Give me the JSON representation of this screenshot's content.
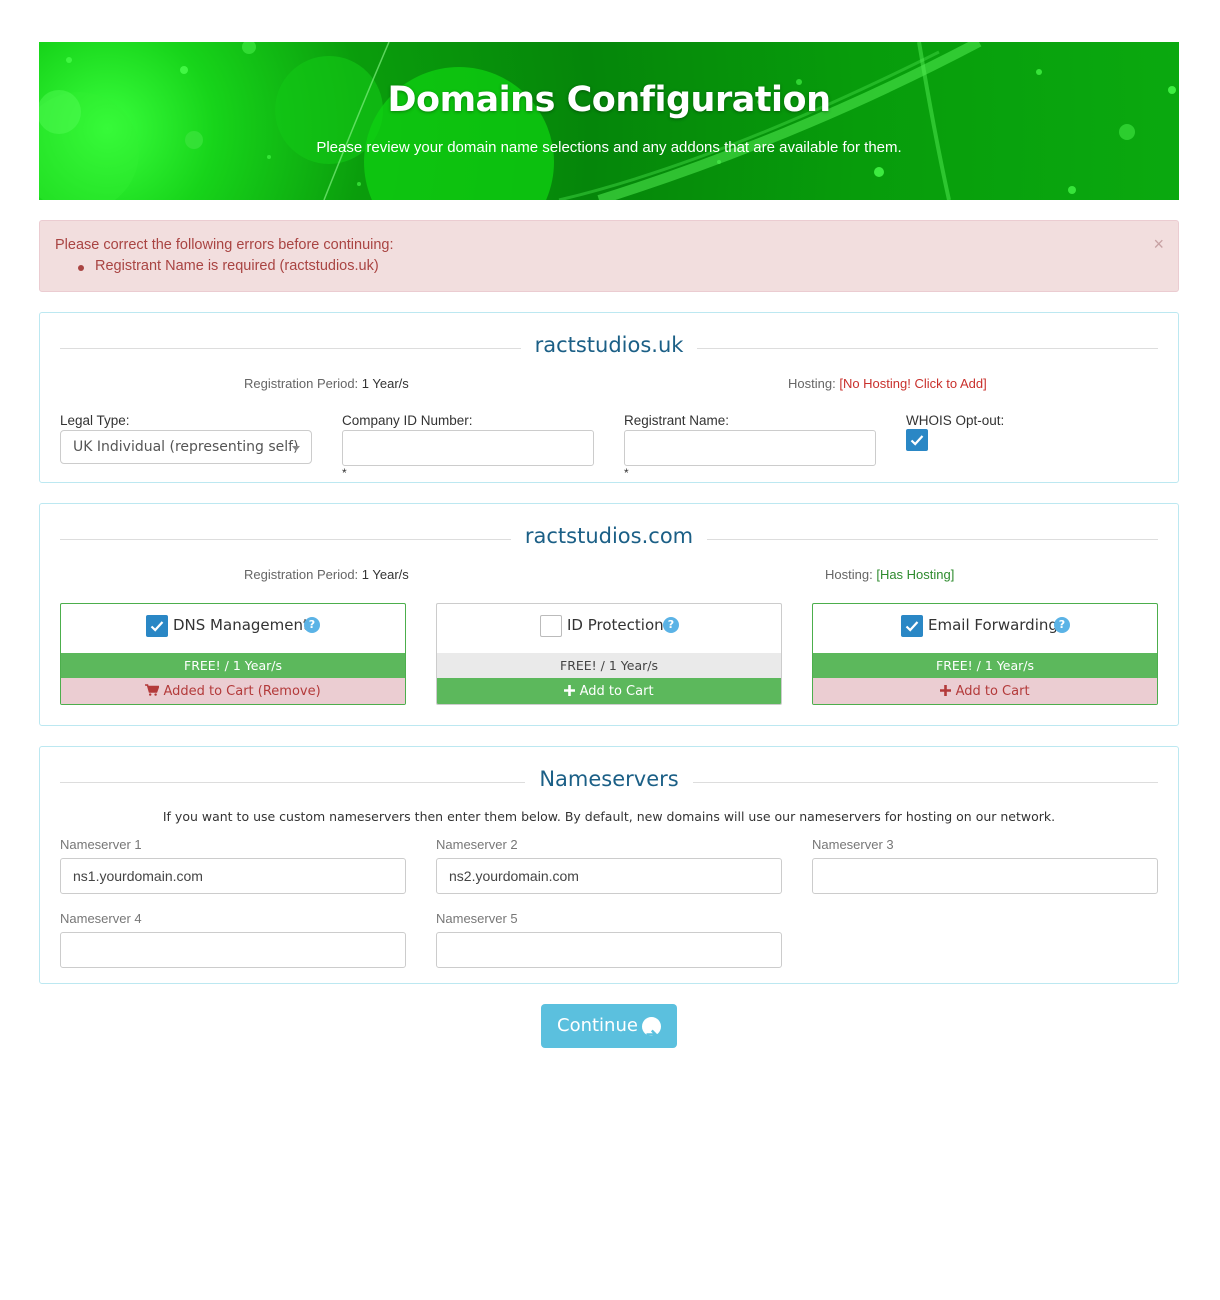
{
  "banner": {
    "title": "Domains Configuration",
    "subtitle": "Please review your domain name selections and any addons that are available for them."
  },
  "alert": {
    "heading": "Please correct the following errors before continuing:",
    "errors": [
      "Registrant Name is required (ractstudios.uk)"
    ],
    "close_glyph": "×"
  },
  "domain_uk": {
    "name": "ractstudios.uk",
    "reg_period_label": "Registration Period:",
    "reg_period_value": "1 Year/s",
    "hosting_label": "Hosting:",
    "hosting_value": "[No Hosting! Click to Add]",
    "legal_type_label": "Legal Type:",
    "legal_type_value": "UK Individual (representing self)",
    "company_id_label": "Company ID Number:",
    "company_id_value": "",
    "registrant_name_label": "Registrant Name:",
    "registrant_name_value": "",
    "required_mark": "*",
    "whois_label": "WHOIS Opt-out:",
    "whois_checked": true
  },
  "domain_com": {
    "name": "ractstudios.com",
    "reg_period_label": "Registration Period:",
    "reg_period_value": "1 Year/s",
    "hosting_label": "Hosting:",
    "hosting_value": "[Has Hosting]",
    "addons": [
      {
        "name": "DNS Management",
        "checked": true,
        "price": "FREE! / 1 Year/s",
        "action": "Added to Cart (Remove)",
        "action_icon": "cart-icon"
      },
      {
        "name": "ID Protection",
        "checked": false,
        "price": "FREE! / 1 Year/s",
        "action": "Add to Cart",
        "action_icon": "plus-icon"
      },
      {
        "name": "Email Forwarding",
        "checked": true,
        "price": "FREE! / 1 Year/s",
        "action": "Add to Cart",
        "action_icon": "plus-icon"
      }
    ],
    "help_glyph": "?"
  },
  "nameservers": {
    "title": "Nameservers",
    "description": "If you want to use custom nameservers then enter them below. By default, new domains will use our nameservers for hosting on our network.",
    "fields": [
      {
        "label": "Nameserver 1",
        "value": "ns1.yourdomain.com"
      },
      {
        "label": "Nameserver 2",
        "value": "ns2.yourdomain.com"
      },
      {
        "label": "Nameserver 3",
        "value": ""
      },
      {
        "label": "Nameserver 4",
        "value": ""
      },
      {
        "label": "Nameserver 5",
        "value": ""
      }
    ]
  },
  "continue_label": "Continue",
  "colors": {
    "banner_green": "#0a9d0c",
    "alert_bg": "#f2dede",
    "alert_text": "#a94442",
    "panel_border": "#bce8f1",
    "title_blue": "#1b5f86",
    "checkbox_blue": "#2a87c5",
    "success_green": "#5cb85c",
    "continue_blue": "#5bc0de"
  }
}
